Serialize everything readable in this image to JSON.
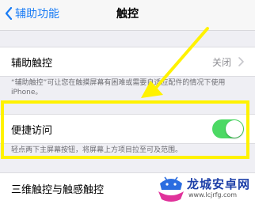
{
  "navbar": {
    "back_label": "辅助功能",
    "title": "触控"
  },
  "assistive_touch": {
    "label": "辅助触控",
    "value": "关闭",
    "footnote": "“辅助触控”可让您在触摸屏幕有困难或需要自适应配件的情况下使用iPhone。"
  },
  "reachability": {
    "label": "便捷访问",
    "toggle_on": true,
    "footnote": "轻点两下主屏幕按钮，将屏幕上方项目拉至可及范围。"
  },
  "three_d_touch": {
    "label": "三维触控与触感触控"
  },
  "watermark": {
    "name": "龙城安卓网",
    "url": "www.lcjrfg.com"
  },
  "colors": {
    "accent": "#1a7cf5",
    "toggle_on": "#4cd964",
    "highlight": "#fff200",
    "background": "#efeff4"
  }
}
